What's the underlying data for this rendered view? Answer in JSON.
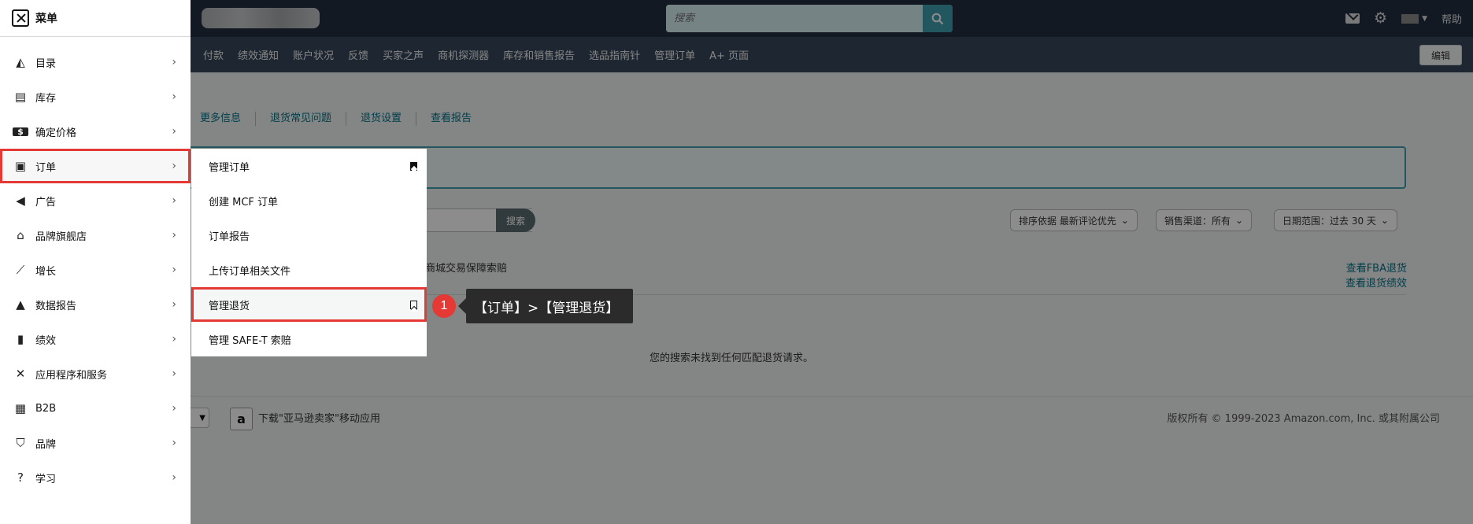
{
  "header": {
    "search_placeholder": "搜索",
    "help_label": "帮助"
  },
  "nav": {
    "links": [
      "付款",
      "绩效通知",
      "账户状况",
      "反馈",
      "买家之声",
      "商机探测器",
      "库存和销售报告",
      "选品指南针",
      "管理订单",
      "A+ 页面"
    ],
    "edit_label": "编辑"
  },
  "background": {
    "subtabs": [
      "更多信息",
      "退货常见问题",
      "退货设置",
      "查看报告"
    ],
    "search_button": "搜索",
    "sort_dropdown": "排序依据 最新评论优先",
    "channel_dropdown": "销售渠道：所有",
    "date_dropdown": "日期范围：过去 30 天",
    "claim_text": "商城交易保障索赔",
    "link_fba": "查看FBA退货",
    "link_performance": "查看退货绩效",
    "empty_message": "您的搜索未找到任何匹配退货请求。",
    "footer_app": "下载\"亚马逊卖家\"移动应用",
    "copyright": "版权所有 © 1999-2023 Amazon.com, Inc. 或其附属公司"
  },
  "menu": {
    "title": "菜单",
    "items": [
      {
        "label": "目录",
        "icon": "tag-icon"
      },
      {
        "label": "库存",
        "icon": "inventory-icon"
      },
      {
        "label": "确定价格",
        "icon": "pricing-icon"
      },
      {
        "label": "订单",
        "icon": "orders-icon"
      },
      {
        "label": "广告",
        "icon": "megaphone-icon"
      },
      {
        "label": "品牌旗舰店",
        "icon": "store-icon"
      },
      {
        "label": "增长",
        "icon": "growth-icon"
      },
      {
        "label": "数据报告",
        "icon": "report-icon"
      },
      {
        "label": "绩效",
        "icon": "bar-chart-icon"
      },
      {
        "label": "应用程序和服务",
        "icon": "tools-icon"
      },
      {
        "label": "B2B",
        "icon": "building-icon"
      },
      {
        "label": "品牌",
        "icon": "shield-icon"
      },
      {
        "label": "学习",
        "icon": "question-icon"
      }
    ]
  },
  "submenu": {
    "items": [
      {
        "label": "管理订单",
        "bookmark": "filled"
      },
      {
        "label": "创建 MCF 订单",
        "bookmark": "none"
      },
      {
        "label": "订单报告",
        "bookmark": "none"
      },
      {
        "label": "上传订单相关文件",
        "bookmark": "none"
      },
      {
        "label": "管理退货",
        "bookmark": "outline"
      },
      {
        "label": "管理 SAFE-T 索赔",
        "bookmark": "none"
      }
    ]
  },
  "annotation": {
    "number": "1",
    "text": "【订单】>【管理退货】"
  },
  "colors": {
    "highlight": "#e53935",
    "topbar": "#232f3e",
    "navbar": "#37475a",
    "accent": "#3f9fae"
  }
}
